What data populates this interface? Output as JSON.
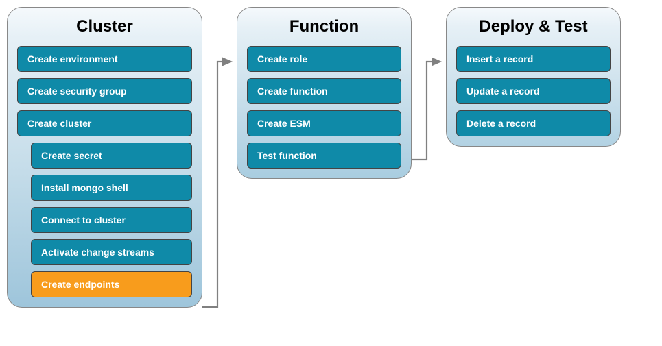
{
  "panels": {
    "cluster": {
      "title": "Cluster",
      "steps": [
        "Create environment",
        "Create security group",
        "Create cluster"
      ],
      "nested_steps": [
        "Create secret",
        "Install mongo shell",
        "Connect to cluster",
        "Activate change streams"
      ],
      "active_step": "Create endpoints"
    },
    "function": {
      "title": "Function",
      "steps": [
        "Create role",
        "Create function",
        "Create ESM",
        "Test function"
      ]
    },
    "deploy": {
      "title": "Deploy & Test",
      "steps": [
        "Insert a record",
        "Update a record",
        "Delete a record"
      ]
    }
  },
  "colors": {
    "step_bg": "#0f8aa8",
    "active_bg": "#f89c1c",
    "arrow": "#808080"
  },
  "chart_data": {
    "type": "diagram",
    "flow": [
      "Cluster",
      "Function",
      "Deploy & Test"
    ],
    "nodes": {
      "Cluster": {
        "steps": [
          "Create environment",
          "Create security group",
          "Create cluster",
          "Create secret",
          "Install mongo shell",
          "Connect to cluster",
          "Activate change streams",
          "Create endpoints"
        ],
        "current": "Create endpoints"
      },
      "Function": {
        "steps": [
          "Create role",
          "Create function",
          "Create ESM",
          "Test function"
        ]
      },
      "Deploy & Test": {
        "steps": [
          "Insert a record",
          "Update a record",
          "Delete a record"
        ]
      }
    }
  }
}
